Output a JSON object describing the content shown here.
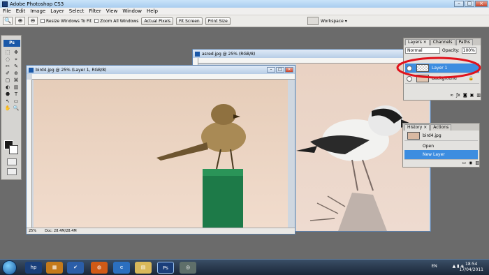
{
  "app": {
    "title": "Adobe Photoshop CS3"
  },
  "window_controls": {
    "minimize": "–",
    "maximize": "□",
    "close": "×"
  },
  "menu": [
    "File",
    "Edit",
    "Image",
    "Layer",
    "Select",
    "Filter",
    "View",
    "Window",
    "Help"
  ],
  "options_bar": {
    "resize_windows": "Resize Windows To Fit",
    "zoom_all": "Zoom All Windows",
    "actual_pixels": "Actual Pixels",
    "fit_screen": "Fit Screen",
    "print_size": "Print Size",
    "workspace": "Workspace ▾"
  },
  "tools": {
    "badge": "Ps",
    "glyphs": [
      "⬚",
      "✥",
      "◌",
      "⌖",
      "✂",
      "✎",
      "✐",
      "⊕",
      "▢",
      "⌘",
      "◐",
      "▥",
      "⬣",
      "T",
      "↖",
      "▭",
      "✋",
      "🔍"
    ]
  },
  "doc_bird4": {
    "title": "bird4.jpg @ 25% (Layer 1, RGB/8)",
    "zoom": "25%",
    "doc": "Doc: 28.4M/28.4M"
  },
  "doc_asred": {
    "title": "asred.jpg @ 25% (RGB/8)"
  },
  "layers_panel": {
    "tabs": [
      "Layers ×",
      "Channels",
      "Paths"
    ],
    "blend": "Normal",
    "opacity_label": "Opacity:",
    "opacity": "100%",
    "layers": [
      "Layer 1",
      "Background"
    ]
  },
  "history_panel": {
    "tabs": [
      "History ×",
      "Actions"
    ],
    "snapshot": "bird4.jpg",
    "states": [
      "Open",
      "New Layer"
    ]
  },
  "taskbar": {
    "language": "EN",
    "time": "18:54",
    "date": "17/04/2011"
  }
}
